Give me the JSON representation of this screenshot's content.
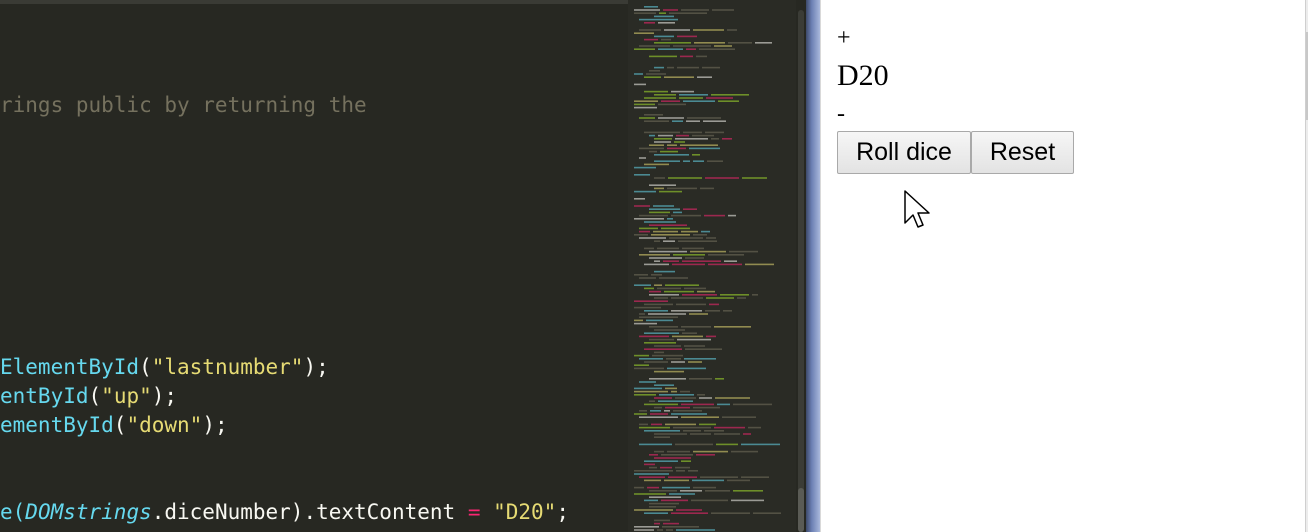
{
  "editor": {
    "lines": [
      {
        "text": "rings public by returning the",
        "kind": "comment"
      },
      {
        "pre": "",
        "fn": "ElementById",
        "open": "(",
        "str": "\"lastnumber\"",
        "close": ");"
      },
      {
        "pre": "",
        "fn": "entById",
        "open": "(",
        "str": "\"up\"",
        "close": ");"
      },
      {
        "pre": "",
        "fn": "ementById",
        "open": "(",
        "str": "\"down\"",
        "close": ");"
      }
    ],
    "last_line": {
      "start": "e(",
      "italic": "DOMstrings",
      "mid": ".diceNumber).textContent ",
      "op": "=",
      "str": " \"D20\"",
      "end": ";"
    }
  },
  "app": {
    "up_label": "+",
    "dice_label": "D20",
    "down_label": "-",
    "roll_button": "Roll dice",
    "reset_button": "Reset"
  },
  "colors": {
    "editor_bg": "#272822",
    "comment": "#75715e",
    "function": "#66d9ef",
    "string": "#e6db74",
    "operator": "#f92672"
  },
  "icons": {
    "cursor": "mouse-pointer-icon"
  }
}
